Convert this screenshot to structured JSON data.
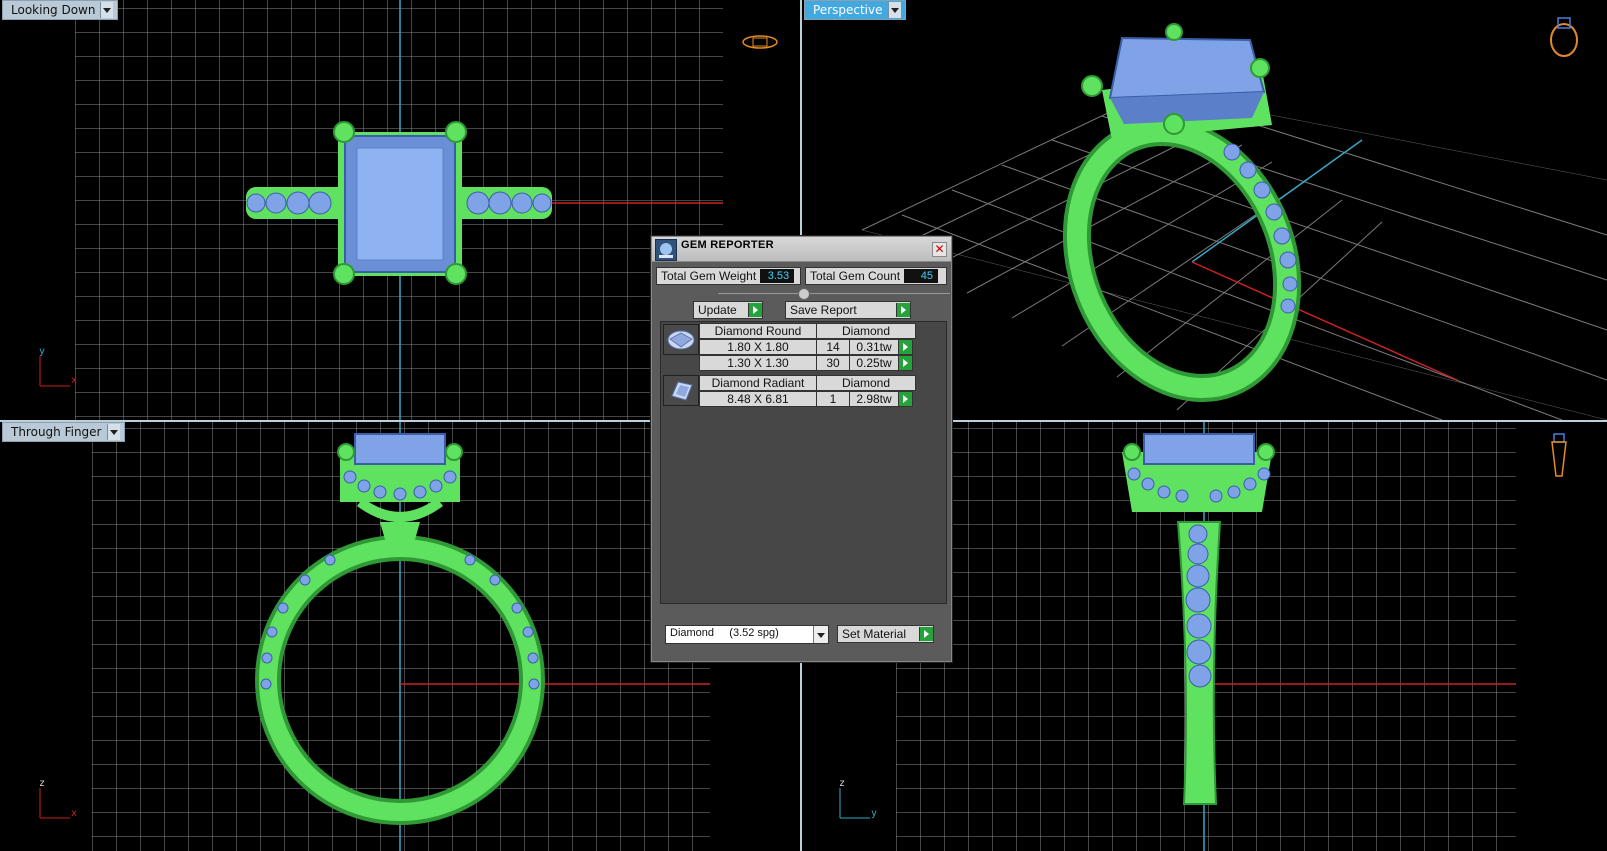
{
  "viewports": {
    "top_left": {
      "label": "Looking Down",
      "axis_v": "y",
      "axis_h": "x"
    },
    "top_right": {
      "label": "Perspective"
    },
    "bottom_left": {
      "label": "Through Finger",
      "axis_v": "z",
      "axis_h": "x"
    },
    "bottom_right": {
      "label": "",
      "axis_v": "z",
      "axis_h": "y"
    }
  },
  "colors": {
    "metal": "#5fe25f",
    "metal_dark": "#2f9a35",
    "gem": "#7fa3e6",
    "gem_dark": "#4d72bf",
    "grid": "#8a8a8a",
    "axis_x": "#cc2222",
    "axis_y": "#36a7c8",
    "active_tab": "#41a9e0"
  },
  "gem_reporter": {
    "title": "GEM REPORTER",
    "total_weight_label": "Total Gem Weight",
    "total_weight": "3.53",
    "total_count_label": "Total Gem Count",
    "total_count": "45",
    "update_label": "Update",
    "save_report_label": "Save Report",
    "groups": [
      {
        "icon": "round-diamond-icon",
        "shape": "Diamond Round",
        "material": "Diamond",
        "rows": [
          {
            "size": "1.80 X 1.80",
            "count": "14",
            "weight": "0.31tw"
          },
          {
            "size": "1.30 X 1.30",
            "count": "30",
            "weight": "0.25tw"
          }
        ]
      },
      {
        "icon": "radiant-diamond-icon",
        "shape": "Diamond Radiant",
        "material": "Diamond",
        "rows": [
          {
            "size": "8.48 X 6.81",
            "count": "1",
            "weight": "2.98tw"
          }
        ]
      }
    ],
    "material_select": "Diamond     (3.52 spg)",
    "set_material_label": "Set Material"
  }
}
